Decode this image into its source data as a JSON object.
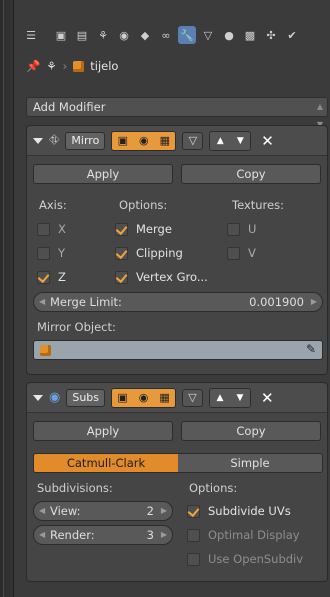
{
  "breadcrumb": {
    "object_name": "tijelo"
  },
  "add_modifier": "Add Modifier",
  "mirror": {
    "name": "Mirro",
    "apply": "Apply",
    "copy": "Copy",
    "axis_label": "Axis:",
    "options_label": "Options:",
    "textures_label": "Textures:",
    "axis": [
      {
        "label": "X",
        "checked": false
      },
      {
        "label": "Y",
        "checked": false
      },
      {
        "label": "Z",
        "checked": true
      }
    ],
    "options": [
      {
        "label": "Merge",
        "checked": true
      },
      {
        "label": "Clipping",
        "checked": true
      },
      {
        "label": "Vertex Gro...",
        "checked": true
      }
    ],
    "textures": [
      {
        "label": "U",
        "checked": false
      },
      {
        "label": "V",
        "checked": false
      }
    ],
    "merge_limit_label": "Merge Limit:",
    "merge_limit_value": "0.001900",
    "mirror_object_label": "Mirror Object:"
  },
  "subsurf": {
    "name": "Subs",
    "apply": "Apply",
    "copy": "Copy",
    "tabs": [
      {
        "label": "Catmull-Clark",
        "active": true
      },
      {
        "label": "Simple",
        "active": false
      }
    ],
    "subdivisions_label": "Subdivisions:",
    "options_label": "Options:",
    "view_label": "View:",
    "view_value": "2",
    "render_label": "Render:",
    "render_value": "3",
    "options": [
      {
        "label": "Subdivide UVs",
        "checked": true,
        "enabled": true
      },
      {
        "label": "Optimal Display",
        "checked": false,
        "enabled": false
      },
      {
        "label": "Use OpenSubdiv",
        "checked": false,
        "enabled": false
      }
    ]
  },
  "colors": {
    "accent": "#e79a3c",
    "active_tab": "#5a7fb1",
    "panel": "#454545"
  }
}
